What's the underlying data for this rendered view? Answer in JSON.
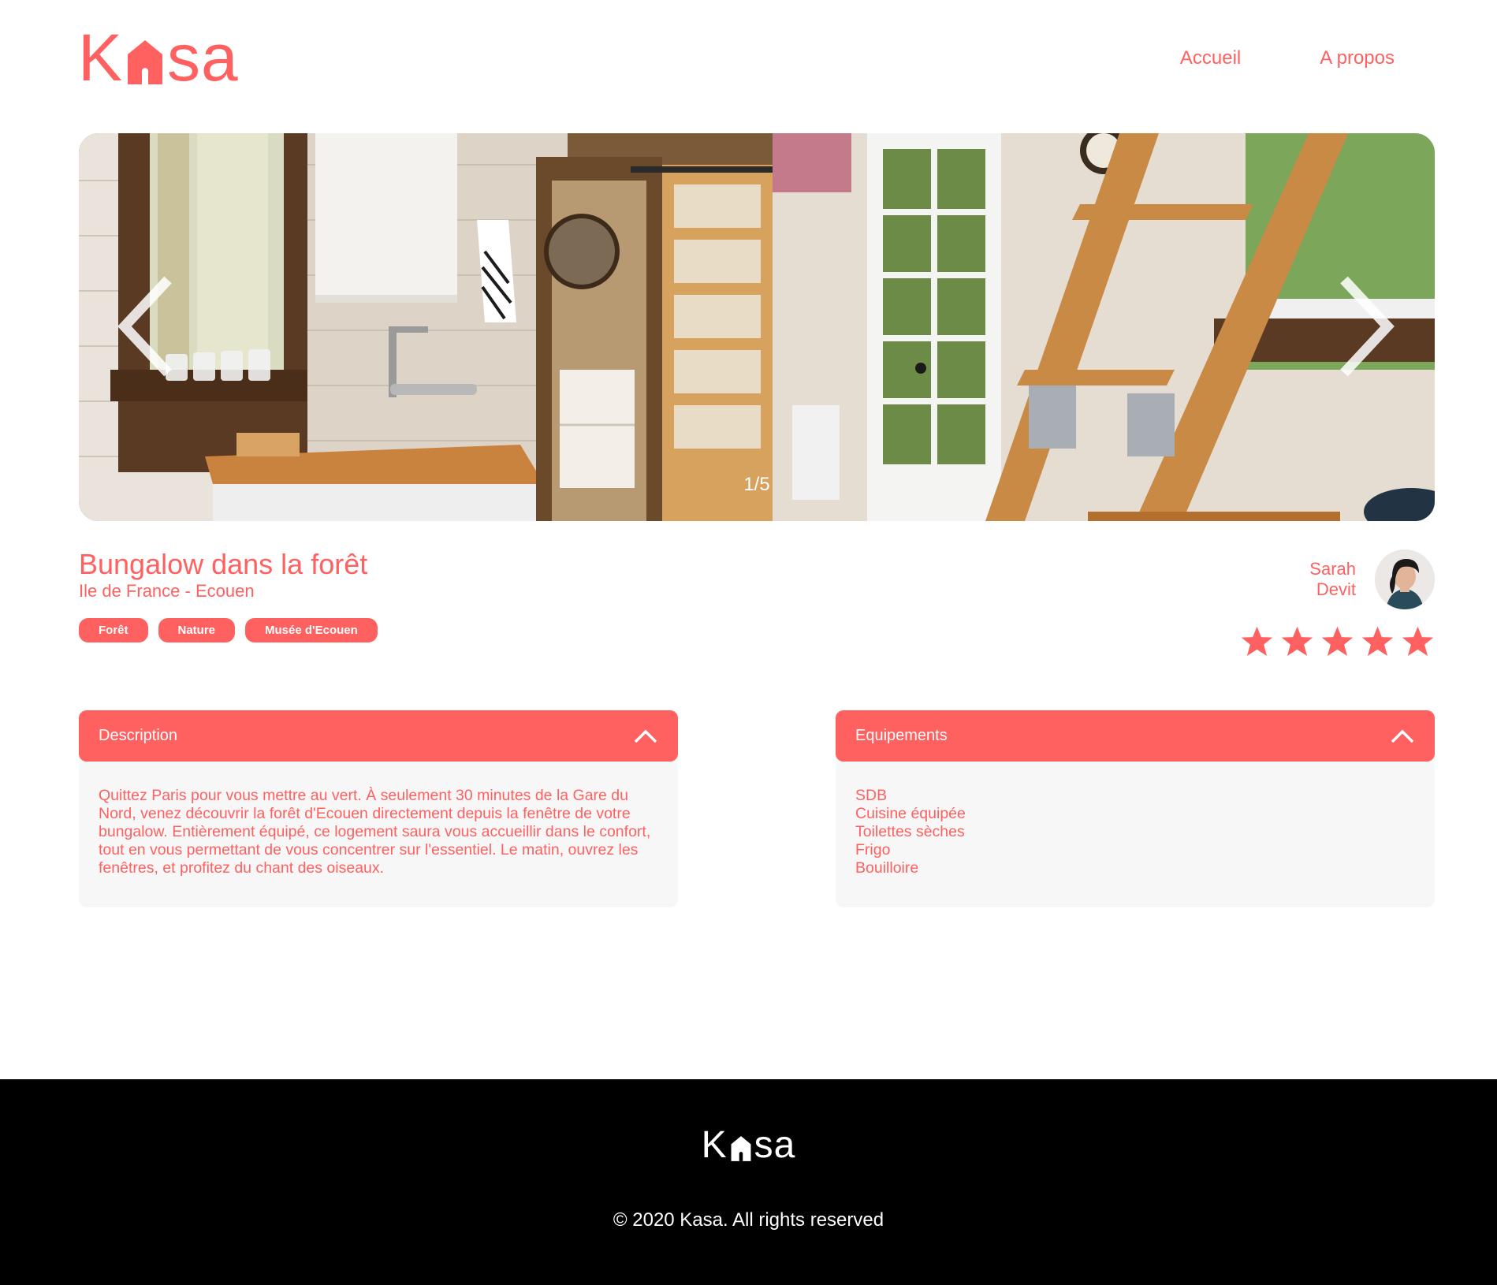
{
  "header": {
    "logo": {
      "before": "K",
      "after": "sa"
    },
    "nav": [
      {
        "label": "Accueil"
      },
      {
        "label": "A propos"
      }
    ]
  },
  "gallery": {
    "counter": "1/5"
  },
  "listing": {
    "title": "Bungalow dans la forêt",
    "location": "Ile de France - Ecouen",
    "tags": [
      "Forêt",
      "Nature",
      "Musée d'Ecouen"
    ]
  },
  "host": {
    "first_name": "Sarah",
    "last_name": "Devit"
  },
  "rating": {
    "value": 5,
    "max": 5,
    "color": "#FF6060"
  },
  "description": {
    "title": "Description",
    "text": "Quittez Paris pour vous mettre au vert. À seulement 30 minutes de la Gare du Nord, venez découvrir la forêt d'Ecouen directement depuis la fenêtre de votre bungalow. Entièrement équipé, ce logement saura vous accueillir dans le confort, tout en vous permettant de vous concentrer sur l'essentiel. Le matin, ouvrez les fenêtres, et profitez du chant des oiseaux."
  },
  "equipments": {
    "title": "Equipements",
    "items": [
      "SDB",
      "Cuisine équipée",
      "Toilettes sèches",
      "Frigo",
      "Bouilloire"
    ]
  },
  "footer": {
    "logo": {
      "before": "K",
      "after": "sa"
    },
    "copyright": "© 2020 Kasa. All rights reserved"
  },
  "colors": {
    "accent": "#FF6060",
    "panel": "#F7F7F7",
    "footer": "#000000"
  }
}
